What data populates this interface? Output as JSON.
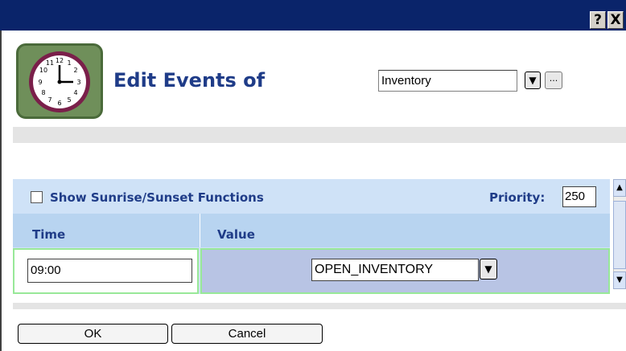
{
  "window": {
    "help_button": "?",
    "close_button": "X"
  },
  "header": {
    "title": "Edit Events of",
    "selected_object": "Inventory",
    "dropdown_glyph": "▼",
    "browse_label": "..."
  },
  "options": {
    "sunrise_sunset_label": "Show Sunrise/Sunset Functions",
    "sunrise_sunset_checked": false,
    "priority_label": "Priority:",
    "priority_value": "250"
  },
  "table": {
    "columns": [
      "Time",
      "Value"
    ],
    "rows": [
      {
        "time": "09:00",
        "value": "OPEN_INVENTORY"
      }
    ]
  },
  "buttons": {
    "ok": "OK",
    "cancel": "Cancel"
  },
  "colors": {
    "title_bar": "#0a246a",
    "heading_text": "#1f3c88",
    "panel_bg": "#cfe2f7",
    "row_highlight_border": "#98e898"
  },
  "icons": [
    "clock-icon",
    "help-icon",
    "close-icon",
    "chevron-down-icon",
    "scroll-up-icon",
    "scroll-down-icon"
  ]
}
